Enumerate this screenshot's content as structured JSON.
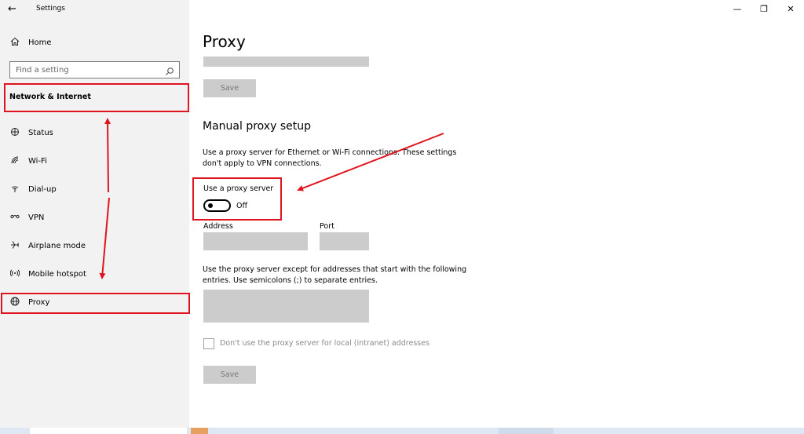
{
  "window": {
    "title": "Settings",
    "controls": {
      "minimize": "—",
      "restore": "❐",
      "close": "✕"
    }
  },
  "sidebar": {
    "home_label": "Home",
    "search_placeholder": "Find a setting",
    "section_heading": "Network & Internet",
    "items": [
      {
        "label": "Status",
        "icon": "status-icon"
      },
      {
        "label": "Wi-Fi",
        "icon": "wifi-icon"
      },
      {
        "label": "Dial-up",
        "icon": "dialup-icon"
      },
      {
        "label": "VPN",
        "icon": "vpn-icon"
      },
      {
        "label": "Airplane mode",
        "icon": "airplane-icon"
      },
      {
        "label": "Mobile hotspot",
        "icon": "hotspot-icon"
      },
      {
        "label": "Proxy",
        "icon": "globe-icon"
      }
    ]
  },
  "main": {
    "title": "Proxy",
    "auto_save_label": "Save",
    "manual": {
      "heading": "Manual proxy setup",
      "description": "Use a proxy server for Ethernet or Wi-Fi connections. These settings don't apply to VPN connections.",
      "use_proxy_label": "Use a proxy server",
      "toggle_state": "Off",
      "address_label": "Address",
      "address_value": "",
      "port_label": "Port",
      "port_value": "",
      "exceptions_description": "Use the proxy server except for addresses that start with the following entries. Use semicolons (;) to separate entries.",
      "exceptions_value": "",
      "local_checkbox_label": "Don't use the proxy server for local (intranet) addresses",
      "local_checkbox_checked": false,
      "save_label": "Save"
    }
  },
  "annotations": {
    "color": "#e0141e"
  },
  "colors": {
    "sidebar_bg": "#f2f2f2",
    "disabled_gray": "#cccccc",
    "taskbar": "#dde8f4"
  }
}
